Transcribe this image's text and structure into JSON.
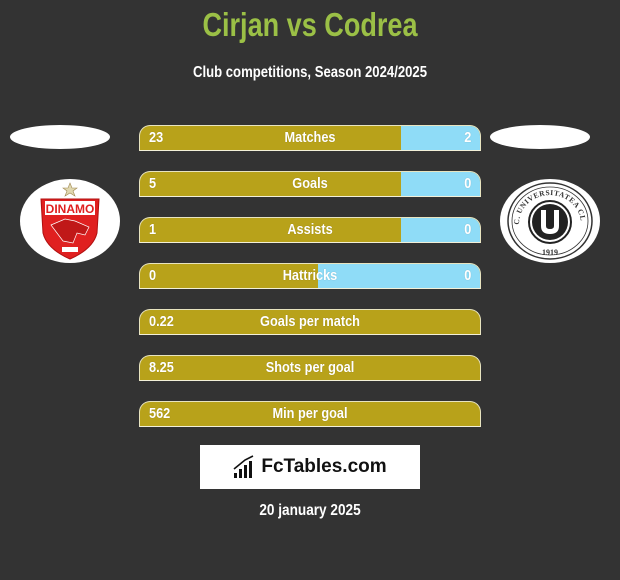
{
  "header": {
    "title": "Cirjan vs Codrea",
    "subtitle": "Club competitions, Season 2024/2025"
  },
  "teams": {
    "left": {
      "name": "Dinamo",
      "logo_icon": "dinamo-crest-icon",
      "logo_text": "DINAMO"
    },
    "right": {
      "name": "FC Universitatea Cluj",
      "logo_icon": "universitatea-cluj-crest-icon",
      "logo_text": "U",
      "ring_text": "F.C. UNIVERSITATEA CLUJ",
      "year": "1919"
    }
  },
  "colors": {
    "background": "#333333",
    "title": "#9bc046",
    "left_bar": "#b8a21a",
    "right_bar": "#8fdcf7"
  },
  "stats": [
    {
      "label": "Matches",
      "left": "23",
      "right": "2",
      "right_share": 0.231
    },
    {
      "label": "Goals",
      "left": "5",
      "right": "0",
      "right_share": 0.231
    },
    {
      "label": "Assists",
      "left": "1",
      "right": "0",
      "right_share": 0.231
    },
    {
      "label": "Hattricks",
      "left": "0",
      "right": "0",
      "right_share": 0.477
    },
    {
      "label": "Goals per match",
      "left": "0.22",
      "right": null,
      "right_share": 0
    },
    {
      "label": "Shots per goal",
      "left": "8.25",
      "right": null,
      "right_share": 0
    },
    {
      "label": "Min per goal",
      "left": "562",
      "right": null,
      "right_share": 0
    }
  ],
  "brand": {
    "icon": "bar-chart-icon",
    "text": "FcTables.com"
  },
  "footer": {
    "date": "20 january 2025"
  }
}
